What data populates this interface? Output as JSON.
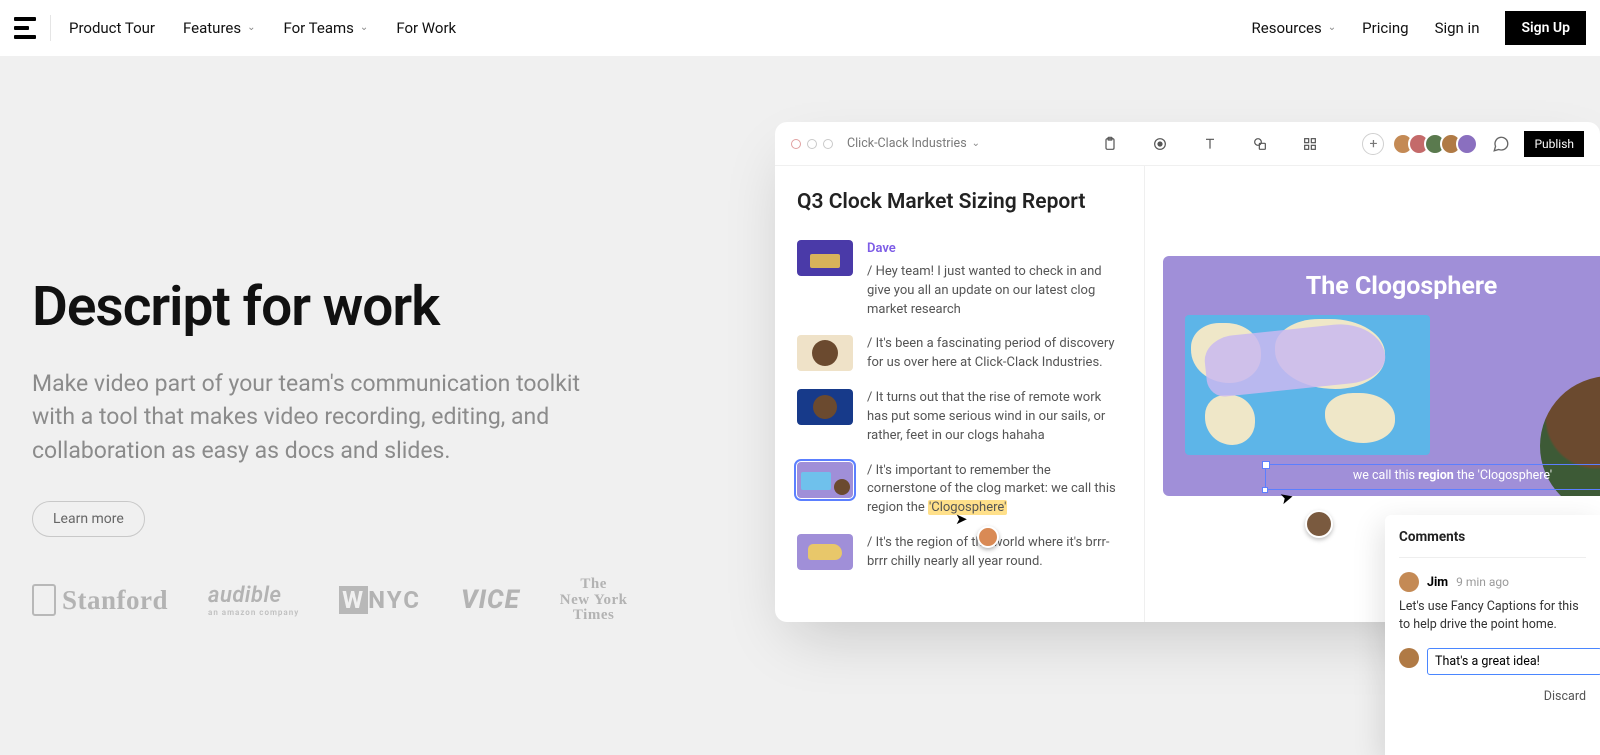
{
  "nav": {
    "items": [
      "Product Tour",
      "Features",
      "For Teams",
      "For Work"
    ],
    "dropdown_flags": [
      false,
      true,
      true,
      false
    ],
    "right": {
      "resources": "Resources",
      "pricing": "Pricing",
      "signin": "Sign in",
      "signup": "Sign Up"
    }
  },
  "hero": {
    "title": "Descript for work",
    "subtitle": "Make video part of your team's communication toolkit with a tool that makes video recording, editing, and collaboration as easy as docs and slides.",
    "cta": "Learn more"
  },
  "brand_logos": [
    "Stanford",
    "audible",
    "WNYC",
    "VICE",
    "The New York Times"
  ],
  "brand_sub": {
    "audible": "an amazon company"
  },
  "app": {
    "project": "Click-Clack Industries",
    "publish": "Publish",
    "doc_title": "Q3 Clock Market Sizing Report",
    "speaker": "Dave",
    "lines": [
      "/ Hey team! I just wanted to check in and give you all an update on our latest clog market research",
      "/ It's been a fascinating period of discovery for us over here at Click-Clack Industries.",
      "/ It turns out that the rise of remote work has put some serious wind in our sails, or rather, feet in our clogs hahaha",
      "/ It's important to remember the cornerstone of the clog market: we call this region the ",
      "/ It's the region of the world where it's brrr-brrr chilly nearly all year round."
    ],
    "highlight": "'Clogosphere'",
    "slide": {
      "title": "The Clogosphere",
      "caption_pre": "we call this ",
      "caption_strong": "region",
      "caption_post": " the 'Clogosphere'"
    },
    "avatar_colors": [
      "#c48a55",
      "#c46a6a",
      "#5a7a4e",
      "#b07a45",
      "#8a6fbf"
    ]
  },
  "comments": {
    "title": "Comments",
    "author": "Jim",
    "time": "9 min ago",
    "body": "Let's use Fancy Captions for this to help drive the point home.",
    "draft": "That's a great idea!",
    "discard": "Discard"
  }
}
